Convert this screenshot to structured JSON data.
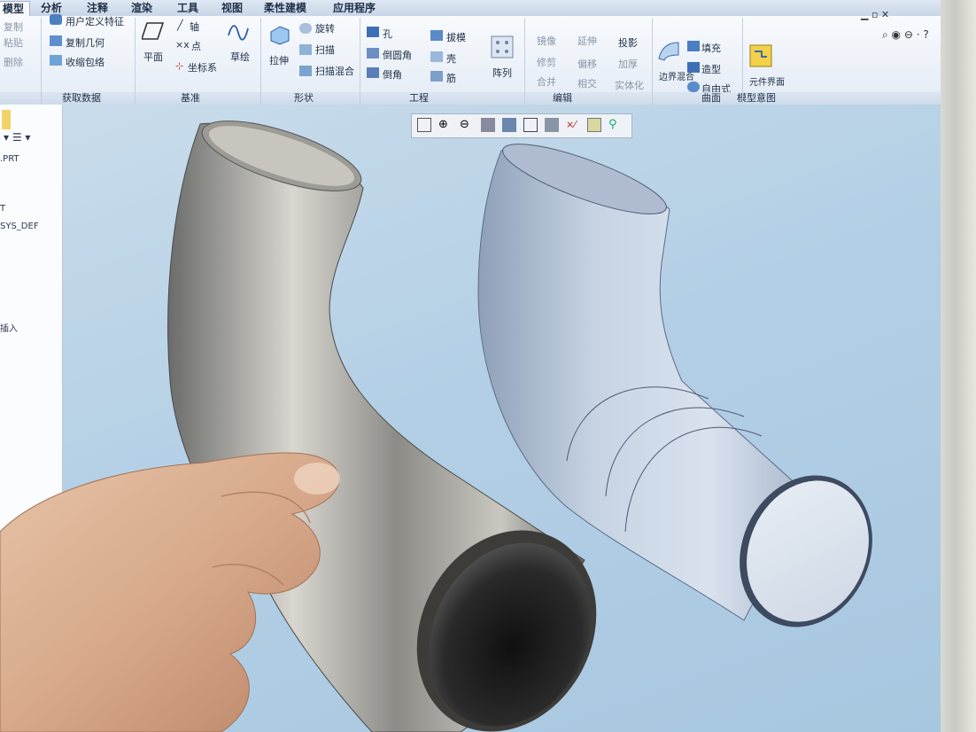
{
  "tabs": [
    "模型",
    "分析",
    "注释",
    "渲染",
    "工具",
    "视图",
    "柔性建模",
    "应用程序"
  ],
  "ribbon": {
    "clipboard": {
      "copy": "复制",
      "paste": "粘贴",
      "delete": "删除"
    },
    "get_data": {
      "udf": "用户定义特征",
      "copy_geom": "复制几何",
      "shrinkwrap": "收缩包络",
      "group": "获取数据"
    },
    "datum": {
      "plane": "平面",
      "axis": "轴",
      "point": "点",
      "csys": "坐标系",
      "sketch": "草绘",
      "group": "基准"
    },
    "shapes": {
      "extrude": "拉伸",
      "revolve": "旋转",
      "sweep": "扫描",
      "swept_blend": "扫描混合",
      "group": "形状"
    },
    "engineering": {
      "hole": "孔",
      "round": "倒圆角",
      "chamfer": "倒角",
      "draft": "拔模",
      "shell": "壳",
      "rib": "筋",
      "group": "工程"
    },
    "pattern": {
      "label": "阵列"
    },
    "editing": {
      "mirror": "镜像",
      "extend": "延伸",
      "project": "投影",
      "trim": "修剪",
      "offset": "偏移",
      "thicken": "加厚",
      "merge": "合并",
      "intersect": "相交",
      "solidify": "实体化",
      "group": "编辑"
    },
    "surfaces": {
      "boundary_blend": "边界混合",
      "fill": "填充",
      "style": "造型",
      "freestyle": "自由式",
      "group": "曲面"
    },
    "model_intent": {
      "component_interface": "元件界面",
      "group": "模型意图"
    }
  },
  "tree": {
    "items": [
      ".PRT",
      "T",
      "SYS_DEF",
      "插入"
    ]
  },
  "icons": [
    "zoom-fit-icon",
    "zoom-in-icon",
    "zoom-out-icon",
    "refit-icon",
    "shaded-icon",
    "view-manager-icon",
    "saved-views-icon",
    "datum-display-icon",
    "spin-center-icon",
    "annotations-icon"
  ],
  "colors": {
    "viewport_top": "#c9dceb",
    "viewport_bottom": "#a7c7e0",
    "model_fill": "#b8c8dc",
    "ribbon": "#f8fafd",
    "tab_bar": "#c8d6e8"
  }
}
